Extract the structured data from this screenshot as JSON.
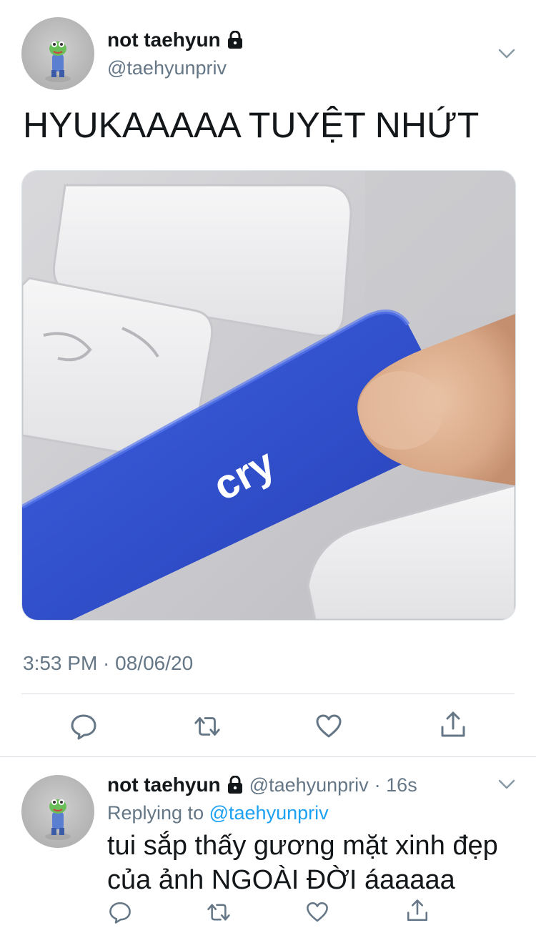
{
  "tweet": {
    "display_name": "not taehyun",
    "handle": "@taehyunpriv",
    "text": "HYUKAAAAA TUYỆT NHỨT",
    "media": {
      "caption_word": "cry",
      "description_icon": "keyboard-cry-key-image"
    },
    "timestamp": "3:53 PM · 08/06/20",
    "icons": {
      "lock": "lock-icon",
      "chevron": "chevron-down-icon",
      "reply": "reply-icon",
      "retweet": "retweet-icon",
      "like": "heart-icon",
      "share": "share-icon"
    }
  },
  "reply": {
    "display_name": "not taehyun",
    "handle": "@taehyunpriv",
    "time": "· 16s",
    "replying_prefix": "Replying to",
    "replying_to": "@taehyunpriv",
    "text_line1": "tui sắp thấy gương mặt xinh đẹp",
    "text_line2": "của ảnh NGOÀI ĐỜI áaaaaa"
  },
  "colors": {
    "text_primary": "#14171a",
    "text_secondary": "#657786",
    "accent": "#1da1f2",
    "key_blue": "#2f4fc8"
  }
}
